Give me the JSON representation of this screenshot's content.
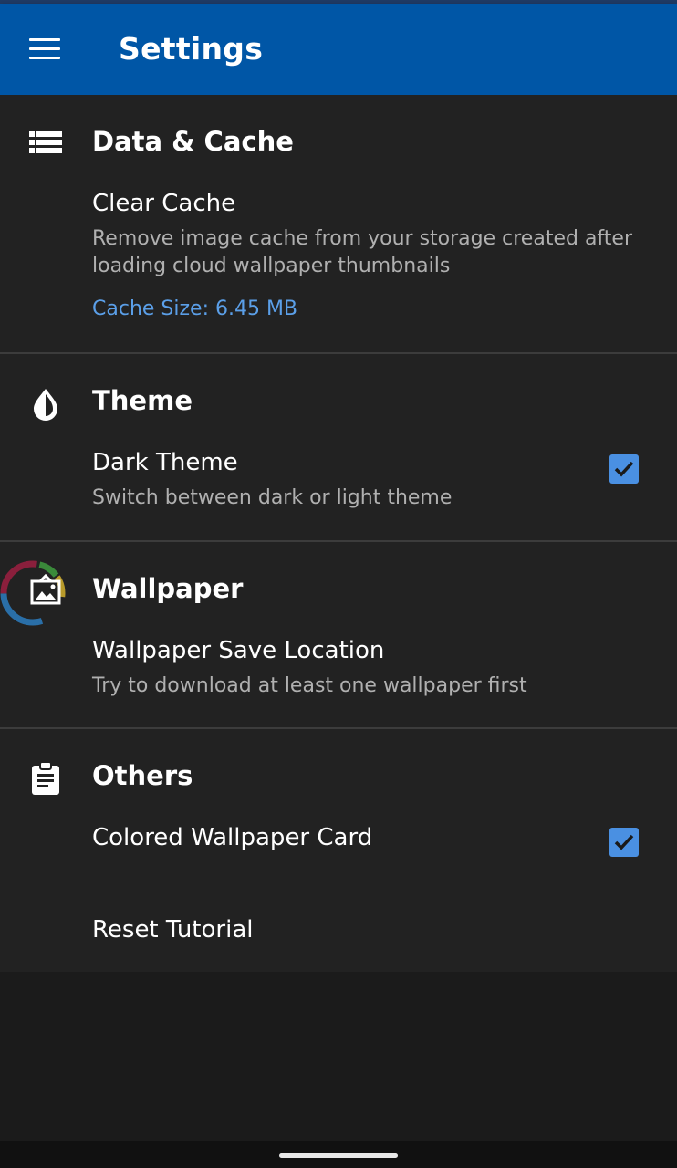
{
  "appbar": {
    "title": "Settings",
    "menu_icon": "hamburger-menu-icon"
  },
  "sections": [
    {
      "title": "Data & Cache",
      "icon": "storage-list-icon",
      "items": [
        {
          "title": "Clear Cache",
          "subtitle": "Remove image cache from your storage created after loading cloud wallpaper thumbnails",
          "extra": "Cache Size: 6.45 MB"
        }
      ]
    },
    {
      "title": "Theme",
      "icon": "water-drop-icon",
      "items": [
        {
          "title": "Dark Theme",
          "subtitle": "Switch between dark or light theme",
          "checked": true
        }
      ]
    },
    {
      "title": "Wallpaper",
      "icon": "wallpaper-icon",
      "items": [
        {
          "title": "Wallpaper Save Location",
          "subtitle": "Try to download at least one wallpaper first"
        }
      ]
    },
    {
      "title": "Others",
      "icon": "clipboard-icon",
      "items": [
        {
          "title": "Colored Wallpaper Card",
          "checked": true
        },
        {
          "title": "Reset Tutorial"
        }
      ]
    }
  ],
  "colors": {
    "appbar": "#0056a6",
    "background": "#222222",
    "accent_link": "#5b9fe8",
    "checkbox": "#4a90e2"
  }
}
